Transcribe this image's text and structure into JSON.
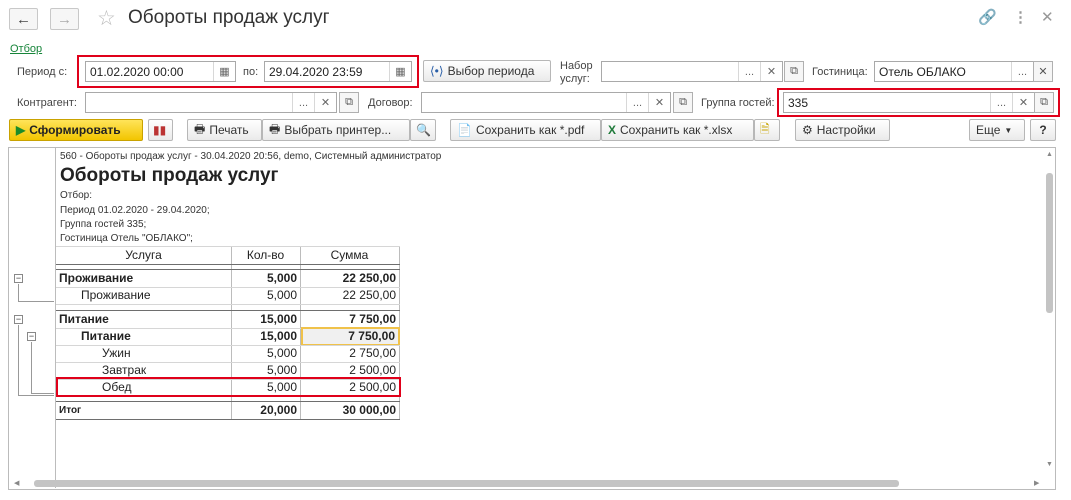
{
  "header": {
    "title": "Обороты продаж услуг",
    "back": "←",
    "forward": "→",
    "link_icon": "link-icon",
    "more_icon": "more-icon",
    "close_icon": "close-icon"
  },
  "filter_link": "Отбор",
  "filters": {
    "period_from_label": "Период с:",
    "period_from": "01.02.2020 00:00",
    "period_to_label": "по:",
    "period_to": "29.04.2020 23:59",
    "period_button": "Выбор периода",
    "services_set_label": "Набор услуг:",
    "services_set": "",
    "hotel_label": "Гостиница:",
    "hotel": "Отель ОБЛАКО",
    "contractor_label": "Контрагент:",
    "contractor": "",
    "contract_label": "Договор:",
    "contract": "",
    "guest_group_label": "Группа гостей:",
    "guest_group": "335"
  },
  "toolbar": {
    "generate": "Сформировать",
    "print": "Печать",
    "choose_printer": "Выбрать принтер...",
    "save_pdf": "Сохранить как *.pdf",
    "save_xlsx": "Сохранить как *.xlsx",
    "settings": "Настройки",
    "more": "Еще",
    "help": "?"
  },
  "report": {
    "meta": "560 - Обороты продаж услуг - 30.04.2020 20:56, demo, Системный администратор",
    "title": "Обороты продаж услуг",
    "filter_caption": "Отбор:",
    "filter_lines": [
      "Период 01.02.2020 - 29.04.2020;",
      "Группа гостей 335;",
      "Гостиница Отель \"ОБЛАКО\";"
    ],
    "columns": [
      "Услуга",
      "Кол-во",
      "Сумма"
    ],
    "rows": [
      {
        "name": "Проживание",
        "qty": "5,000",
        "sum": "22 250,00"
      },
      {
        "name": "Проживание",
        "qty": "5,000",
        "sum": "22 250,00"
      },
      {
        "name": "Питание",
        "qty": "15,000",
        "sum": "7 750,00"
      },
      {
        "name": "Питание",
        "qty": "15,000",
        "sum": "7 750,00"
      },
      {
        "name": "Ужин",
        "qty": "5,000",
        "sum": "2 750,00"
      },
      {
        "name": "Завтрак",
        "qty": "5,000",
        "sum": "2 500,00"
      },
      {
        "name": "Обед",
        "qty": "5,000",
        "sum": "2 500,00"
      }
    ],
    "total": {
      "name": "Итог",
      "qty": "20,000",
      "sum": "30 000,00"
    }
  }
}
